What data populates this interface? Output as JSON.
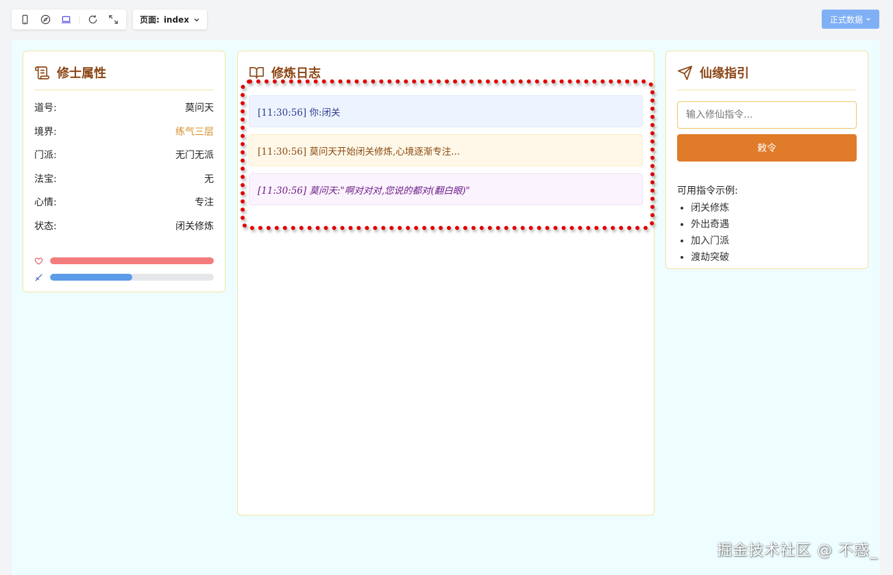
{
  "toolbar": {
    "page_prefix": "页面:",
    "page_name": "index",
    "data_button_label": "正式数据"
  },
  "attributes": {
    "title": "修士属性",
    "rows": [
      {
        "label": "道号:",
        "value": "莫问天"
      },
      {
        "label": "境界:",
        "value": "练气三层"
      },
      {
        "label": "门派:",
        "value": "无门无派"
      },
      {
        "label": "法宝:",
        "value": "无"
      },
      {
        "label": "心情:",
        "value": "专注"
      },
      {
        "label": "状态:",
        "value": "闭关修炼"
      }
    ],
    "health_fraction": 1.0,
    "mana_fraction": 0.5,
    "health_color": "#f47c7c",
    "mana_color": "#5b9be8",
    "realm_color": "#d4902a"
  },
  "log": {
    "title": "修炼日志",
    "entries": [
      {
        "type": "user",
        "text": "[11:30:56] 你:闭关"
      },
      {
        "type": "sys",
        "text": "[11:30:56] 莫问天开始闭关修炼,心境逐渐专注..."
      },
      {
        "type": "npc",
        "text": "[11:30:56] 莫问天:\"啊对对对,您说的都对(翻白眼)\""
      }
    ]
  },
  "guide": {
    "title": "仙缘指引",
    "input_placeholder": "输入修仙指令...",
    "submit_label": "敕令",
    "examples_heading": "可用指令示例:",
    "examples": [
      "闭关修炼",
      "外出奇遇",
      "加入门派",
      "渡劫突破"
    ],
    "accent_color": "#e07b2a"
  },
  "watermark": "掘金技术社区 @ 不惑_"
}
